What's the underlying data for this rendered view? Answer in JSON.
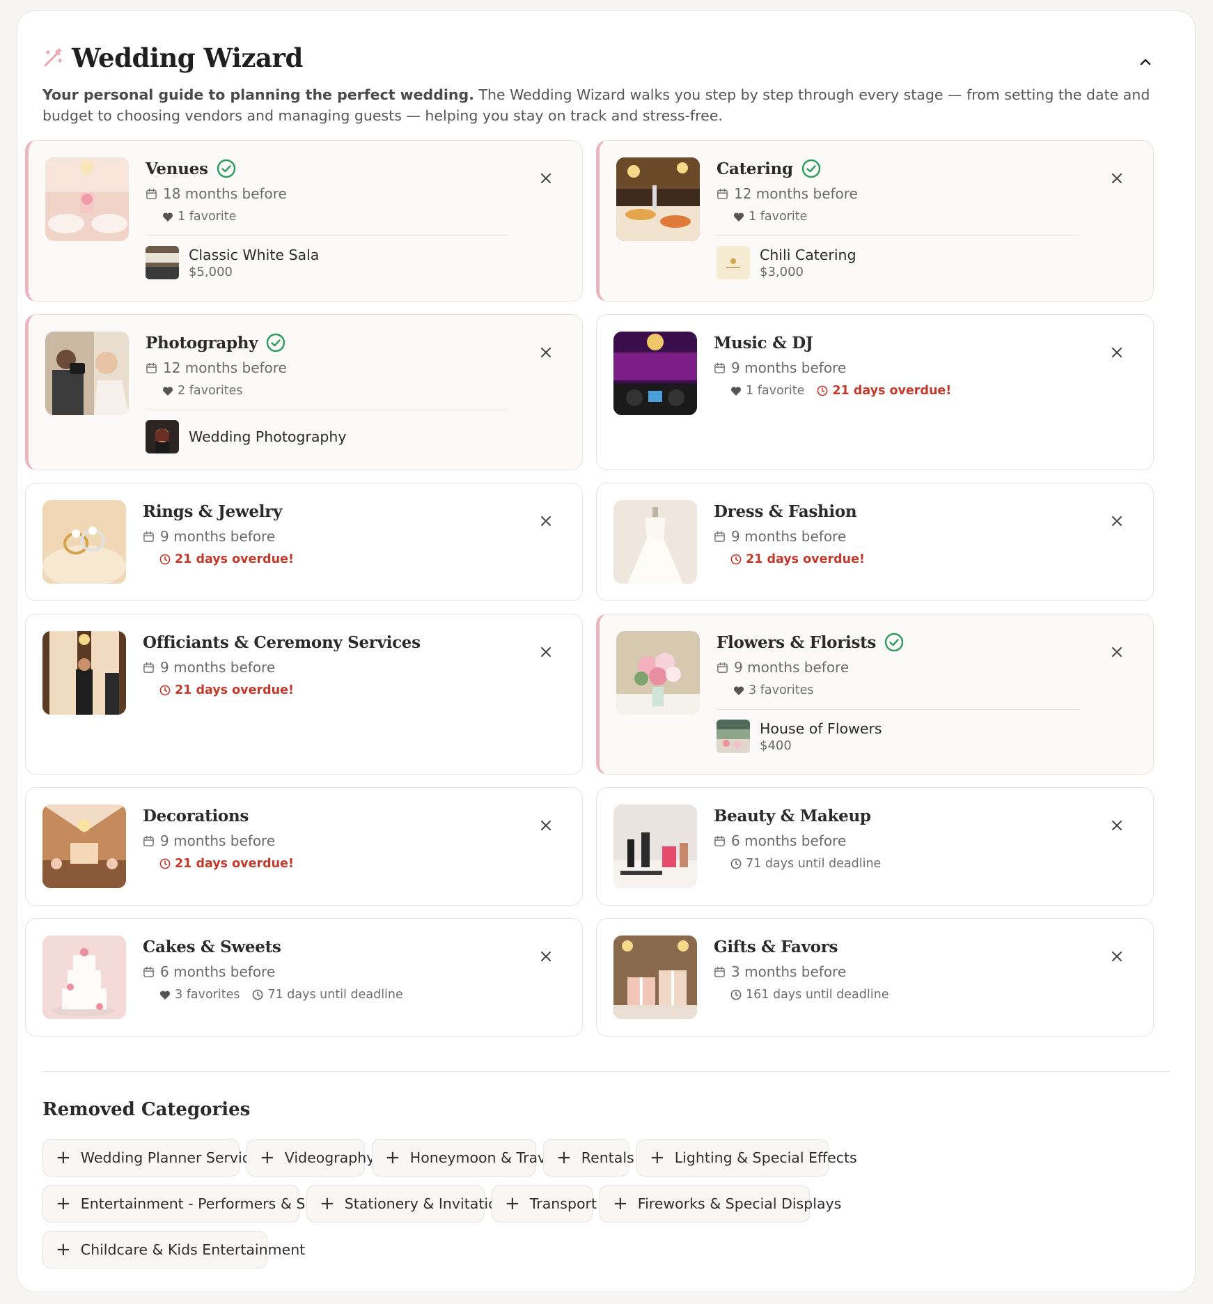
{
  "wizard": {
    "title": "Wedding Wizard",
    "intro_bold": "Your personal guide to planning the perfect wedding.",
    "intro_rest": " The Wedding Wizard walks you step by step through every stage — from setting the date and budget to choosing vendors and managing guests — helping you stay on track and stress-free."
  },
  "cards": [
    {
      "title": "Venues",
      "timing": "18 months before",
      "favorites": "1 favorite",
      "status": "",
      "vendor": "Classic White Sala",
      "price": "$5,000"
    },
    {
      "title": "Catering",
      "timing": "12 months before",
      "favorites": "1 favorite",
      "status": "",
      "vendor": "Chili Catering",
      "price": "$3,000"
    },
    {
      "title": "Photography",
      "timing": "12 months before",
      "favorites": "2 favorites",
      "status": "",
      "vendor": "Wedding Photography",
      "price": ""
    },
    {
      "title": "Music & DJ",
      "timing": "9 months before",
      "favorites": "1 favorite",
      "status": "21 days overdue!"
    },
    {
      "title": "Rings & Jewelry",
      "timing": "9 months before",
      "favorites": "",
      "status": "21 days overdue!"
    },
    {
      "title": "Dress & Fashion",
      "timing": "9 months before",
      "favorites": "",
      "status": "21 days overdue!"
    },
    {
      "title": "Officiants & Ceremony Services",
      "timing": "9 months before",
      "favorites": "",
      "status": "21 days overdue!"
    },
    {
      "title": "Flowers & Florists",
      "timing": "9 months before",
      "favorites": "3 favorites",
      "status": "",
      "vendor": "House of Flowers",
      "price": "$400"
    },
    {
      "title": "Decorations",
      "timing": "9 months before",
      "favorites": "",
      "status": "21 days overdue!"
    },
    {
      "title": "Beauty & Makeup",
      "timing": "6 months before",
      "favorites": "",
      "status": "71 days until deadline"
    },
    {
      "title": "Cakes & Sweets",
      "timing": "6 months before",
      "favorites": "3 favorites",
      "status": "71 days until deadline"
    },
    {
      "title": "Gifts & Favors",
      "timing": "3 months before",
      "favorites": "",
      "status": "161 days until deadline"
    }
  ],
  "removed": {
    "title": "Removed Categories",
    "items": [
      "Wedding Planner Services",
      "Videography",
      "Honeymoon & Travel",
      "Rentals",
      "Lighting & Special Effects",
      "Entertainment - Performers & Shows",
      "Stationery & Invitations",
      "Transport",
      "Fireworks & Special Displays",
      "Childcare & Kids Entertainment"
    ]
  },
  "colors": {
    "accent_pink": "#eab4c1",
    "check_green": "#2e9a5b",
    "overdue_red": "#c0392b"
  },
  "icons": [
    "magic-wand-icon",
    "chevron-up-icon",
    "calendar-icon",
    "heart-icon",
    "clock-icon",
    "check-circle-icon",
    "close-icon",
    "plus-icon"
  ]
}
